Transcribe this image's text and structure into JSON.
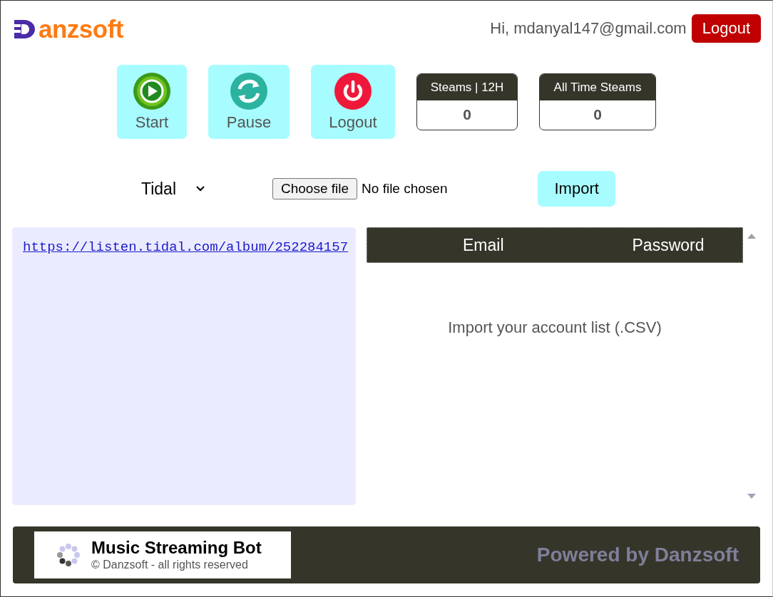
{
  "brand": {
    "name": "anzsoft"
  },
  "user": {
    "greeting": "Hi, mdanyal147@gmail.com",
    "logout": "Logout"
  },
  "actions": [
    {
      "label": "Start",
      "kind": "start"
    },
    {
      "label": "Pause",
      "kind": "pause"
    },
    {
      "label": "Logout",
      "kind": "logout"
    }
  ],
  "stats": [
    {
      "label": "Steams | 12H",
      "value": "0"
    },
    {
      "label": "All Time Steams",
      "value": "0"
    }
  ],
  "platform": {
    "value": "Tidal"
  },
  "file": {
    "button": "Choose file",
    "status": "No file chosen"
  },
  "import_button": "Import",
  "links_box": {
    "value": "https://listen.tidal.com/album/252284157"
  },
  "accounts": {
    "columns": [
      "Email",
      "Password"
    ],
    "empty_message": "Import your account list (.CSV)"
  },
  "footer": {
    "title": "Music Streaming Bot",
    "copyright": "© Danzsoft - all rights reserved",
    "powered": "Powered by Danzsoft"
  }
}
